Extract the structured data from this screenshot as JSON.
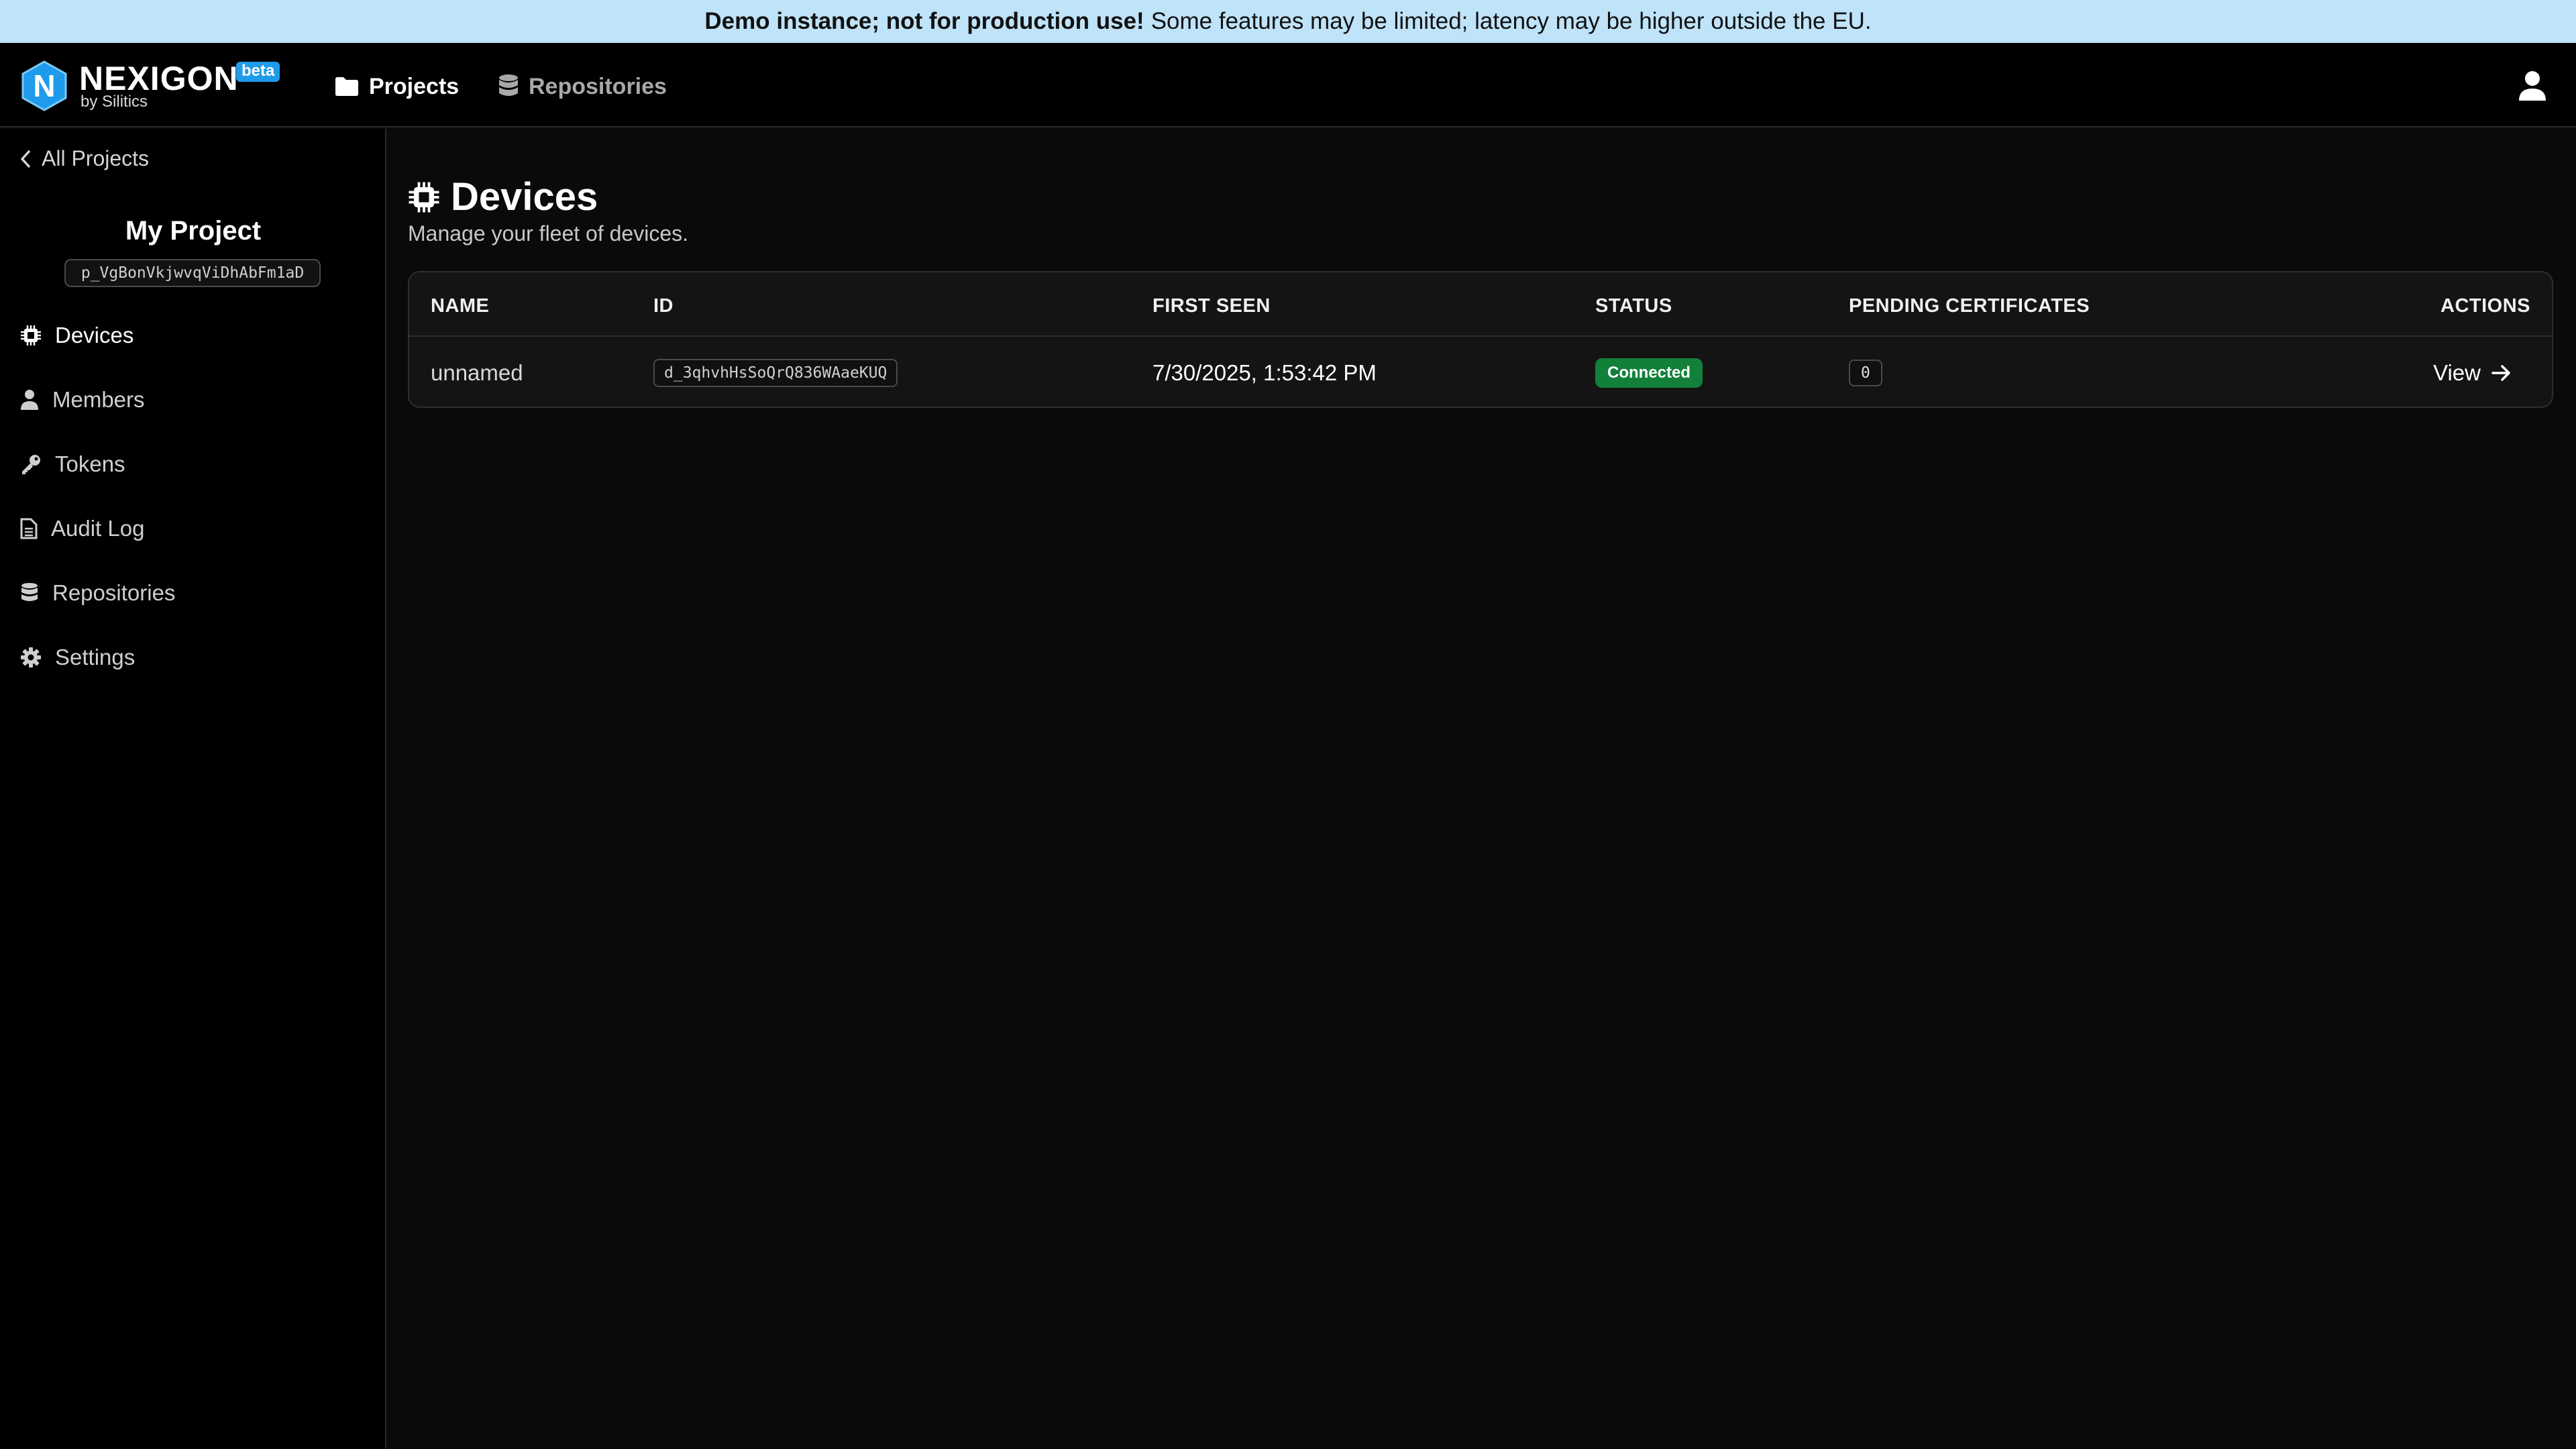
{
  "banner": {
    "bold": "Demo instance; not for production use!",
    "text": "Some features may be limited; latency may be higher outside the EU."
  },
  "header": {
    "logo_name": "NEXIGON",
    "logo_sub": "by Silitics",
    "beta": "beta",
    "nav": [
      {
        "label": "Projects",
        "icon": "folder-icon",
        "active": true
      },
      {
        "label": "Repositories",
        "icon": "database-icon",
        "active": false
      }
    ],
    "user_icon": "user-icon"
  },
  "sidebar": {
    "back_label": "All Projects",
    "project_name": "My Project",
    "project_id": "p_VgBonVkjwvqViDhAbFm1aD",
    "items": [
      {
        "label": "Devices",
        "icon": "chip-icon",
        "active": true
      },
      {
        "label": "Members",
        "icon": "user-icon",
        "active": false
      },
      {
        "label": "Tokens",
        "icon": "key-icon",
        "active": false
      },
      {
        "label": "Audit Log",
        "icon": "document-icon",
        "active": false
      },
      {
        "label": "Repositories",
        "icon": "database-icon",
        "active": false
      },
      {
        "label": "Settings",
        "icon": "gear-icon",
        "active": false
      }
    ]
  },
  "main": {
    "title": "Devices",
    "subtitle": "Manage your fleet of devices.",
    "table": {
      "columns": [
        "NAME",
        "ID",
        "FIRST SEEN",
        "STATUS",
        "PENDING CERTIFICATES",
        "ACTIONS"
      ],
      "rows": [
        {
          "name": "unnamed",
          "id": "d_3qhvhHsSoQrQ836WAaeKUQ",
          "first_seen": "7/30/2025, 1:53:42 PM",
          "status": "Connected",
          "pending_certificates": "0",
          "action": "View"
        }
      ]
    }
  },
  "colors": {
    "banner_bg": "#bfe3f8",
    "accent": "#1e9bea",
    "status_connected": "#13803a",
    "background": "#0a0a0a"
  }
}
